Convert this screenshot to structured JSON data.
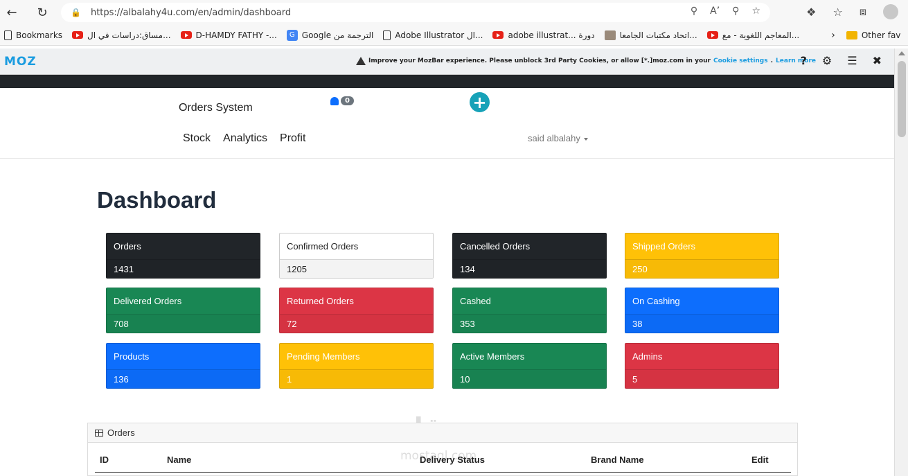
{
  "browser": {
    "url": "https://albalahy4u.com/en/admin/dashboard",
    "bookmarks": [
      {
        "label": "Bookmarks",
        "icon": "page"
      },
      {
        "label": "مساق:دراسات في ال...",
        "icon": "youtube"
      },
      {
        "label": "D-HAMDY FATHY -...",
        "icon": "youtube"
      },
      {
        "label": "Google الترجمة من",
        "icon": "google"
      },
      {
        "label": "Adobe Illustrator ال...",
        "icon": "page"
      },
      {
        "label": "adobe illustrat... دورة",
        "icon": "youtube"
      },
      {
        "label": "اتحاد مكتبات الجامعا...",
        "icon": "image"
      },
      {
        "label": "المعاجم اللغوية - مع...",
        "icon": "youtube"
      }
    ],
    "other_favorites": "Other fav"
  },
  "mozbar": {
    "logo": "MOZ",
    "message": "Improve your MozBar experience. Please unblock 3rd Party Cookies, or allow [*.]moz.com in your",
    "cookie_link": "Cookie settings",
    "learn_link": "Learn more"
  },
  "navbar": {
    "brand": "Orders System",
    "notification_count": "0",
    "links": [
      "Stock",
      "Analytics",
      "Profit"
    ],
    "user": "said albalahy"
  },
  "page_title": "Dashboard",
  "cards": [
    {
      "label": "Orders",
      "value": "1431",
      "style": "dark"
    },
    {
      "label": "Confirmed Orders",
      "value": "1205",
      "style": "light"
    },
    {
      "label": "Cancelled Orders",
      "value": "134",
      "style": "dark"
    },
    {
      "label": "Shipped Orders",
      "value": "250",
      "style": "yellow"
    },
    {
      "label": "Delivered Orders",
      "value": "708",
      "style": "green"
    },
    {
      "label": "Returned Orders",
      "value": "72",
      "style": "red"
    },
    {
      "label": "Cashed",
      "value": "353",
      "style": "green"
    },
    {
      "label": "On Cashing",
      "value": "38",
      "style": "blue"
    },
    {
      "label": "Products",
      "value": "136",
      "style": "blue"
    },
    {
      "label": "Pending Members",
      "value": "1",
      "style": "yellow"
    },
    {
      "label": "Active Members",
      "value": "10",
      "style": "green"
    },
    {
      "label": "Admins",
      "value": "5",
      "style": "red"
    }
  ],
  "orders_table": {
    "title": "Orders",
    "columns": [
      "ID",
      "Name",
      "Delivery Status",
      "Brand Name",
      "Edit"
    ]
  },
  "watermark": {
    "main": "مستقل",
    "sub": "mostaql.com"
  }
}
